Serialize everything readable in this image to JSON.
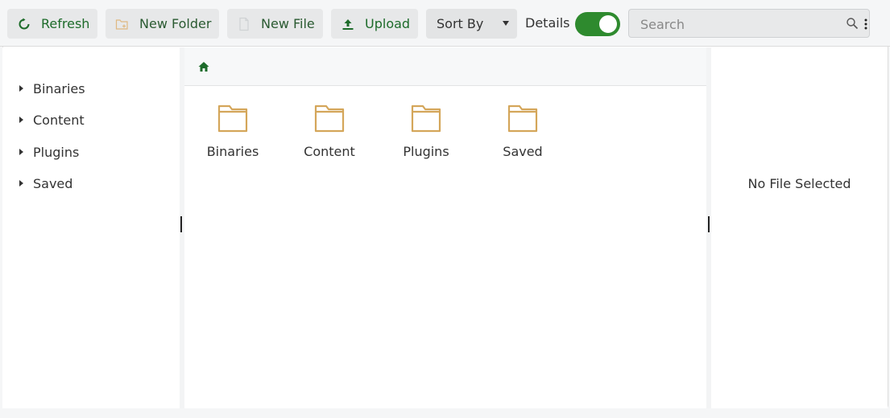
{
  "toolbar": {
    "refresh_label": "Refresh",
    "new_folder_label": "New Folder",
    "new_file_label": "New File",
    "upload_label": "Upload",
    "sort_label": "Sort By",
    "details_label": "Details",
    "details_on": true,
    "search_placeholder": "Search"
  },
  "sidebar": {
    "items": [
      {
        "label": "Binaries"
      },
      {
        "label": "Content"
      },
      {
        "label": "Plugins"
      },
      {
        "label": "Saved"
      }
    ]
  },
  "main": {
    "folders": [
      {
        "label": "Binaries"
      },
      {
        "label": "Content"
      },
      {
        "label": "Plugins"
      },
      {
        "label": "Saved"
      }
    ]
  },
  "details": {
    "empty_text": "No File Selected"
  },
  "colors": {
    "accent": "#2e8a2e",
    "folder": "#d4a65a",
    "button_text": "#1d6b2a"
  },
  "icons": {
    "refresh": "refresh-icon",
    "new_folder": "new-folder-icon",
    "new_file": "new-file-icon",
    "upload": "upload-icon",
    "search": "search-icon",
    "more": "more-vertical-icon",
    "home": "home-icon",
    "folder": "folder-icon"
  }
}
